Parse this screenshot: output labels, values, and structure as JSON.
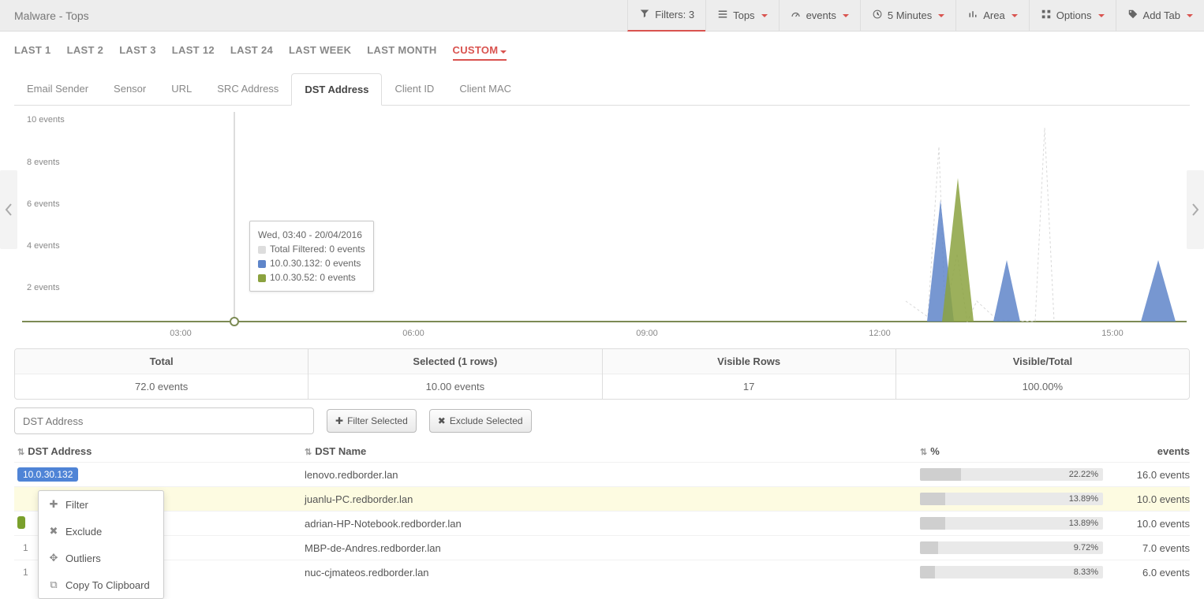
{
  "title": "Malware - Tops",
  "topbar": {
    "filters": "Filters: 3",
    "tops": "Tops",
    "events": "events",
    "interval": "5 Minutes",
    "area": "Area",
    "options": "Options",
    "addtab": "Add Tab"
  },
  "ranges": [
    "LAST 1",
    "LAST 2",
    "LAST 3",
    "LAST 12",
    "LAST 24",
    "LAST WEEK",
    "LAST MONTH"
  ],
  "custom": "CUSTOM",
  "tabs": [
    "Email Sender",
    "Sensor",
    "URL",
    "SRC Address",
    "DST Address",
    "Client ID",
    "Client MAC"
  ],
  "tooltip": {
    "time": "Wed, 03:40 - 20/04/2016",
    "total": "Total Filtered: 0 events",
    "s1": "10.0.30.132: 0 events",
    "s2": "10.0.30.52: 0 events"
  },
  "summary": {
    "head": {
      "total": "Total",
      "selected": "Selected (1 rows)",
      "visible": "Visible Rows",
      "vt": "Visible/Total"
    },
    "val": {
      "total": "72.0 events",
      "selected": "10.00 events",
      "visible": "17",
      "vt": "100.00%"
    }
  },
  "filterPlaceholder": "DST Address",
  "btnFilter": "Filter Selected",
  "btnExclude": "Exclude Selected",
  "cols": {
    "dst": "DST Address",
    "name": "DST Name",
    "pct": "%",
    "events": "events"
  },
  "rows": [
    {
      "ip": "10.0.30.132",
      "color": "#4f84d6",
      "name": "lenovo.redborder.lan",
      "pct": "22.22%",
      "pctw": 22.22,
      "events": "16.0 events"
    },
    {
      "ip": "",
      "color": "#e08b3e",
      "name": "juanlu-PC.redborder.lan",
      "pct": "13.89%",
      "pctw": 13.89,
      "events": "10.0 events",
      "hl": true,
      "hideIp": true
    },
    {
      "ip": "",
      "color": "#7aa02c",
      "name": "adrian-HP-Notebook.redborder.lan",
      "pct": "13.89%",
      "pctw": 13.89,
      "events": "10.0 events",
      "hideIp": true,
      "stub": true
    },
    {
      "ip": "1",
      "color": "",
      "name": "MBP-de-Andres.redborder.lan",
      "pct": "9.72%",
      "pctw": 9.72,
      "events": "7.0 events",
      "plain": true
    },
    {
      "ip": "1",
      "color": "",
      "name": "nuc-cjmateos.redborder.lan",
      "pct": "8.33%",
      "pctw": 8.33,
      "events": "6.0 events",
      "plain": true
    }
  ],
  "ctx": {
    "filter": "Filter",
    "exclude": "Exclude",
    "outliers": "Outliers",
    "copy": "Copy To Clipboard"
  },
  "chart_data": {
    "type": "area",
    "ylabel": "events",
    "ylim": [
      0,
      10
    ],
    "yticks": [
      2,
      4,
      6,
      8,
      10
    ],
    "xticks": [
      "03:00",
      "06:00",
      "09:00",
      "12:00",
      "15:00"
    ],
    "xrange_minutes": [
      0,
      780
    ],
    "hover_x_minute": 40,
    "series": [
      {
        "name": "10.0.30.132",
        "color": "#5f85c9",
        "points": [
          [
            595,
            6
          ],
          [
            615,
            3
          ],
          [
            715,
            3
          ]
        ]
      },
      {
        "name": "10.0.30.52",
        "color": "#8ba23f",
        "points": [
          [
            607,
            7
          ]
        ]
      }
    ],
    "ghost_series": [
      {
        "points": [
          [
            562,
            1
          ],
          [
            585,
            8
          ],
          [
            595,
            3
          ],
          [
            613,
            4
          ],
          [
            630,
            9
          ]
        ]
      }
    ]
  }
}
